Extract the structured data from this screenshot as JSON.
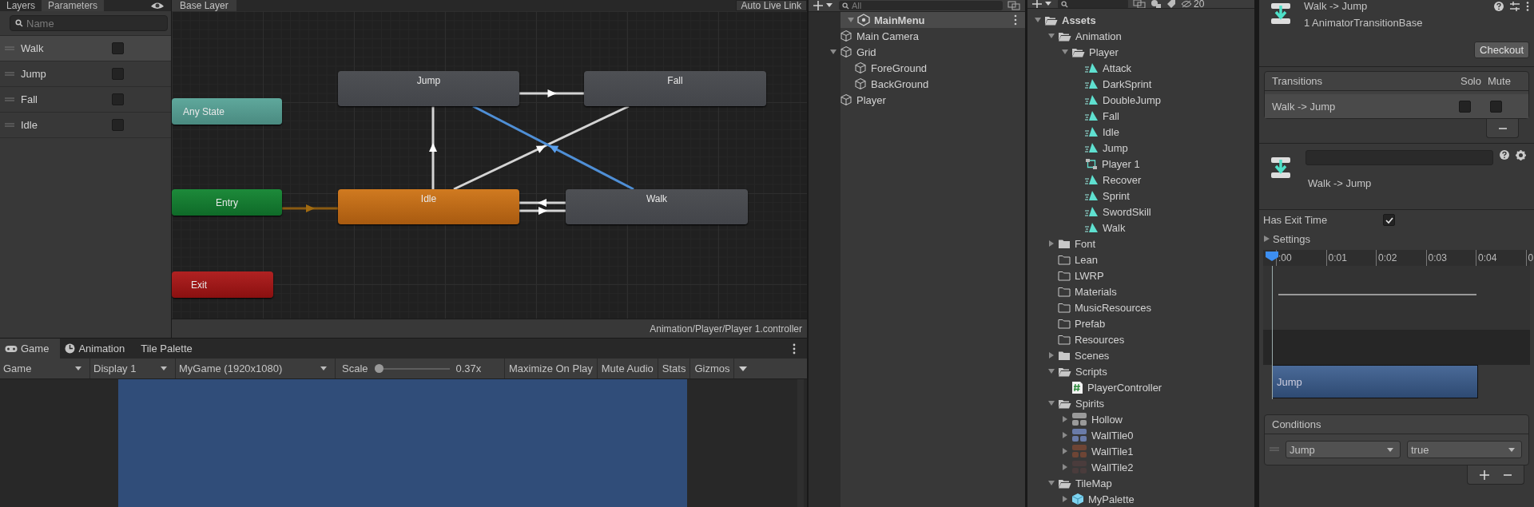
{
  "animator": {
    "tabs": [
      {
        "label": "Layers",
        "selected": false
      },
      {
        "label": "Parameters",
        "selected": true
      }
    ],
    "breadcrumb": "Base Layer",
    "live_link_button": "Auto Live Link",
    "parameter_search": {
      "placeholder": "Name"
    },
    "parameters": [
      {
        "name": "Walk",
        "selected": true,
        "checked": false
      },
      {
        "name": "Jump",
        "selected": false,
        "checked": false
      },
      {
        "name": "Fall",
        "selected": false,
        "checked": false
      },
      {
        "name": "Idle",
        "selected": false,
        "checked": false
      }
    ],
    "states": [
      {
        "label": "Jump",
        "kind": "state"
      },
      {
        "label": "Fall",
        "kind": "state"
      },
      {
        "label": "Any State",
        "kind": "any"
      },
      {
        "label": "Entry",
        "kind": "entry"
      },
      {
        "label": "Idle",
        "kind": "default"
      },
      {
        "label": "Walk",
        "kind": "state"
      },
      {
        "label": "Exit",
        "kind": "exit"
      }
    ],
    "asset_path": "Animation/Player/Player 1.controller"
  },
  "game": {
    "tabs": [
      {
        "label": "Game",
        "kind": "game",
        "selected": true
      },
      {
        "label": "Animation",
        "kind": "animation",
        "selected": false
      },
      {
        "label": "Tile Palette",
        "kind": "palette",
        "selected": false
      }
    ],
    "toolbar": {
      "view": "Game",
      "display": "Display 1",
      "resolution": "MyGame (1920x1080)",
      "scale_label": "Scale",
      "scale": {
        "level": 0.03
      },
      "scale_reading": "0.37x",
      "buttons": [
        "Maximize On Play",
        "Mute Audio",
        "Stats",
        "Gizmos"
      ]
    }
  },
  "hierarchy": {
    "search": {
      "placeholder": "All"
    },
    "scene": {
      "name": "MainMenu",
      "expanded": true,
      "children": [
        {
          "name": "Main Camera"
        },
        {
          "name": "Grid",
          "expanded": true,
          "children": [
            {
              "name": "ForeGround"
            },
            {
              "name": "BackGround"
            }
          ]
        },
        {
          "name": "Player"
        }
      ]
    }
  },
  "project": {
    "hidden_count": "20",
    "tree": [
      {
        "name": "Assets",
        "kind": "folder",
        "expanded": true,
        "children": [
          {
            "name": "Animation",
            "kind": "folder",
            "expanded": true,
            "children": [
              {
                "name": "Player",
                "kind": "folder",
                "expanded": true,
                "children": [
                  {
                    "name": "Attack",
                    "kind": "clip"
                  },
                  {
                    "name": "DarkSprint",
                    "kind": "clip"
                  },
                  {
                    "name": "DoubleJump",
                    "kind": "clip"
                  },
                  {
                    "name": "Fall",
                    "kind": "clip"
                  },
                  {
                    "name": "Idle",
                    "kind": "clip"
                  },
                  {
                    "name": "Jump",
                    "kind": "clip"
                  },
                  {
                    "name": "Player 1",
                    "kind": "controller"
                  },
                  {
                    "name": "Recover",
                    "kind": "clip"
                  },
                  {
                    "name": "Sprint",
                    "kind": "clip"
                  },
                  {
                    "name": "SwordSkill",
                    "kind": "clip"
                  },
                  {
                    "name": "Walk",
                    "kind": "clip"
                  }
                ]
              }
            ]
          },
          {
            "name": "Font",
            "kind": "folder",
            "expanded": false
          },
          {
            "name": "Lean",
            "kind": "empty-folder"
          },
          {
            "name": "LWRP",
            "kind": "empty-folder"
          },
          {
            "name": "Materials",
            "kind": "empty-folder"
          },
          {
            "name": "MusicResources",
            "kind": "empty-folder"
          },
          {
            "name": "Prefab",
            "kind": "empty-folder"
          },
          {
            "name": "Resources",
            "kind": "empty-folder"
          },
          {
            "name": "Scenes",
            "kind": "folder",
            "expanded": false
          },
          {
            "name": "Scripts",
            "kind": "folder",
            "expanded": true,
            "children": [
              {
                "name": "PlayerController",
                "kind": "script"
              }
            ]
          },
          {
            "name": "Spirits",
            "kind": "folder",
            "expanded": true,
            "children": [
              {
                "name": "Hollow",
                "kind": "sprite",
                "expanded": false,
                "color": "#9a9a9a"
              },
              {
                "name": "WallTile0",
                "kind": "sprite",
                "expanded": false,
                "color": "#6a7ba8"
              },
              {
                "name": "WallTile1",
                "kind": "sprite",
                "expanded": false,
                "color": "#6e4535"
              },
              {
                "name": "WallTile2",
                "kind": "sprite",
                "expanded": false,
                "color": "#4a3c3c"
              }
            ]
          },
          {
            "name": "TileMap",
            "kind": "folder",
            "expanded": true,
            "children": [
              {
                "name": "MyPalette",
                "kind": "palette",
                "expanded": false
              }
            ]
          }
        ]
      }
    ]
  },
  "inspector": {
    "title": "Walk -> Jump",
    "subtitle": "1 AnimatorTransitionBase",
    "checkout_button": "Checkout",
    "transitions": {
      "header": "Transitions",
      "solo_label": "Solo",
      "mute_label": "Mute",
      "rows": [
        {
          "name": "Walk -> Jump",
          "solo": false,
          "mute": false,
          "selected": true
        }
      ]
    },
    "transition_label": "Walk -> Jump",
    "has_exit_time": {
      "label": "Has Exit Time",
      "checked": true
    },
    "settings": {
      "label": "Settings",
      "expanded": false
    },
    "timeline": {
      "ticks": [
        ":00",
        "0:01",
        "0:02",
        "0:03",
        "0:04",
        "0"
      ],
      "clip": "Jump"
    },
    "conditions": {
      "header": "Conditions",
      "rows": [
        {
          "parameter": "Jump",
          "value": "true"
        }
      ]
    }
  }
}
